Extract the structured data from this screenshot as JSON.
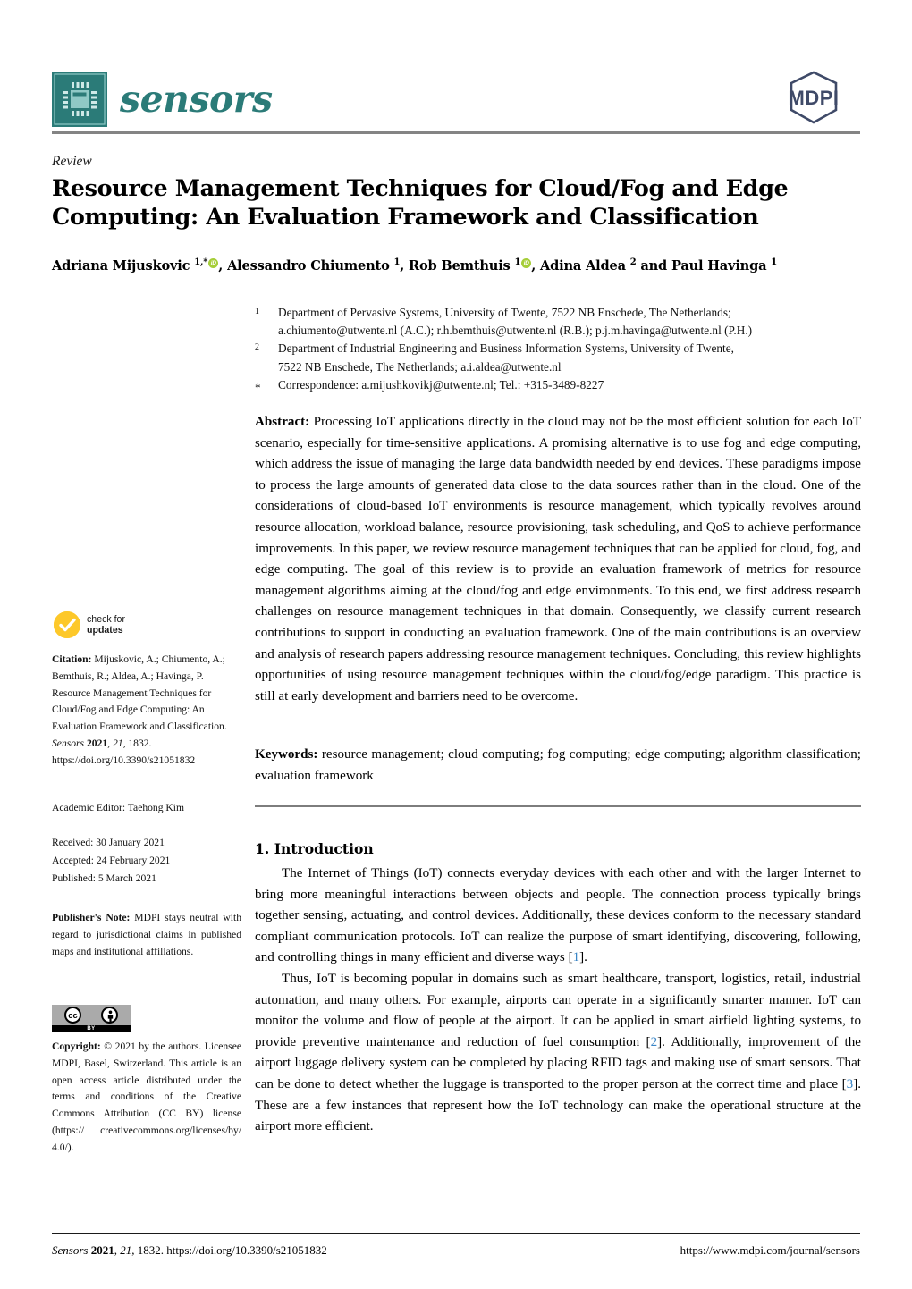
{
  "header": {
    "journal_name": "sensors",
    "publisher_logo_text": "MDPI",
    "chip_icon": "microchip-icon"
  },
  "title_block": {
    "doc_type": "Review",
    "title": "Resource Management Techniques for Cloud/Fog and Edge Computing: An Evaluation Framework and Classification"
  },
  "authors": {
    "list": [
      {
        "name": "Adriana Mijuskovic",
        "marks": "1,*",
        "orcid": true,
        "sep": ", "
      },
      {
        "name": "Alessandro Chiumento",
        "marks": "1",
        "orcid": false,
        "sep": ", "
      },
      {
        "name": "Rob Bemthuis",
        "marks": "1",
        "orcid": true,
        "sep": ", "
      },
      {
        "name": "Adina Aldea",
        "marks": "2",
        "orcid": false,
        "sep": " and "
      },
      {
        "name": "Paul Havinga",
        "marks": "1",
        "orcid": false,
        "sep": ""
      }
    ]
  },
  "affiliations": [
    {
      "mark": "1",
      "lines": [
        "Department of Pervasive Systems, University of Twente, 7522 NB Enschede, The Netherlands;",
        "a.chiumento@utwente.nl (A.C.); r.h.bemthuis@utwente.nl (R.B.); p.j.m.havinga@utwente.nl (P.H.)"
      ]
    },
    {
      "mark": "2",
      "lines": [
        "Department of Industrial Engineering and Business Information Systems, University of Twente,",
        "7522 NB Enschede, The Netherlands; a.i.aldea@utwente.nl"
      ]
    },
    {
      "mark": "*",
      "lines": [
        "Correspondence: a.mijushkovikj@utwente.nl; Tel.: +315-3489-8227"
      ]
    }
  ],
  "abstract": {
    "label": "Abstract:",
    "text": "Processing IoT applications directly in the cloud may not be the most efficient solution for each IoT scenario, especially for time-sensitive applications. A promising alternative is to use fog and edge computing, which address the issue of managing the large data bandwidth needed by end devices. These paradigms impose to process the large amounts of generated data close to the data sources rather than in the cloud. One of the considerations of cloud-based IoT environments is resource management, which typically revolves around resource allocation, workload balance, resource provisioning, task scheduling, and QoS to achieve performance improvements. In this paper, we review resource management techniques that can be applied for cloud, fog, and edge computing. The goal of this review is to provide an evaluation framework of metrics for resource management algorithms aiming at the cloud/fog and edge environments. To this end, we first address research challenges on resource management techniques in that domain. Consequently, we classify current research contributions to support in conducting an evaluation framework. One of the main contributions is an overview and analysis of research papers addressing resource management techniques. Concluding, this review highlights opportunities of using resource management techniques within the cloud/fog/edge paradigm. This practice is still at early development and barriers need to be overcome."
  },
  "keywords": {
    "label": "Keywords:",
    "text": "resource management; cloud computing; fog computing; edge computing; algorithm classification; evaluation framework"
  },
  "sidebar": {
    "check_for_updates": {
      "line1": "check for",
      "line2": "updates",
      "icon": "check-circle-icon",
      "color": "#fdc82a"
    },
    "citation": {
      "label": "Citation:",
      "text": "Mijuskovic, A.; Chiumento, A.; Bemthuis, R.; Aldea, A.; Havinga, P. Resource Management Techniques for Cloud/Fog and Edge Computing: An Evaluation Framework and Classification.",
      "journal": "Sensors",
      "year": "2021",
      "volume": "21",
      "article": "1832.",
      "doi": "https://doi.org/10.3390/s21051832"
    },
    "academic_editor": "Academic Editor: Taehong Kim",
    "dates": [
      "Received: 30 January 2021",
      "Accepted: 24 February 2021",
      "Published: 5 March 2021"
    ],
    "publishers_note": {
      "label": "Publisher's Note:",
      "text": "MDPI stays neutral with regard to jurisdictional claims in published maps and institutional affiliations."
    },
    "cc_badge": {
      "cc_mark": "cc",
      "by_mark": "BY",
      "person_icon": "person-icon"
    },
    "copyright": {
      "label": "Copyright:",
      "text": "© 2021 by the authors. Licensee MDPI, Basel, Switzerland. This article is an open access article distributed under the terms and conditions of the Creative Commons Attribution (CC BY) license (https:// creativecommons.org/licenses/by/ 4.0/)."
    }
  },
  "body": {
    "section_heading": "1. Introduction",
    "paragraph1_a": "The Internet of Things (IoT) connects everyday devices with each other and with the larger Internet to bring more meaningful interactions between objects and people. The connection process typically brings together sensing, actuating, and control devices. Additionally, these devices conform to the necessary standard compliant communication protocols. IoT can realize the purpose of smart identifying, discovering, following, and controlling things in many efficient and diverse ways [",
    "paragraph1_cite": "1",
    "paragraph1_b": "].",
    "paragraph2_a": "Thus, IoT is becoming popular in domains such as smart healthcare, transport, logistics, retail, industrial automation, and many others. For example, airports can operate in a significantly smarter manner. IoT can monitor the volume and flow of people at the airport. It can be applied in smart airfield lighting systems, to provide preventive maintenance and reduction of fuel consumption [",
    "paragraph2_cite1": "2",
    "paragraph2_b": "]. Additionally, improvement of the airport luggage delivery system can be completed by placing RFID tags and making use of smart sensors. That can be done to detect whether the luggage is transported to the proper person at the correct time and place [",
    "paragraph2_cite2": "3",
    "paragraph2_c": "]. These are a few instances that represent how the IoT technology can make the operational structure at the airport more efficient."
  },
  "footer": {
    "journal": "Sensors",
    "year": "2021",
    "volume": "21",
    "article": "1832.",
    "doi": "https://doi.org/10.3390/s21051832",
    "url": "https://www.mdpi.com/journal/sensors"
  },
  "colors": {
    "brand_teal": "#2b7b78",
    "mdpi_navy": "#3f4a68",
    "citation_link": "#3a85c6",
    "orcid_green": "#a6ce39",
    "check_yellow": "#fdc82a"
  }
}
